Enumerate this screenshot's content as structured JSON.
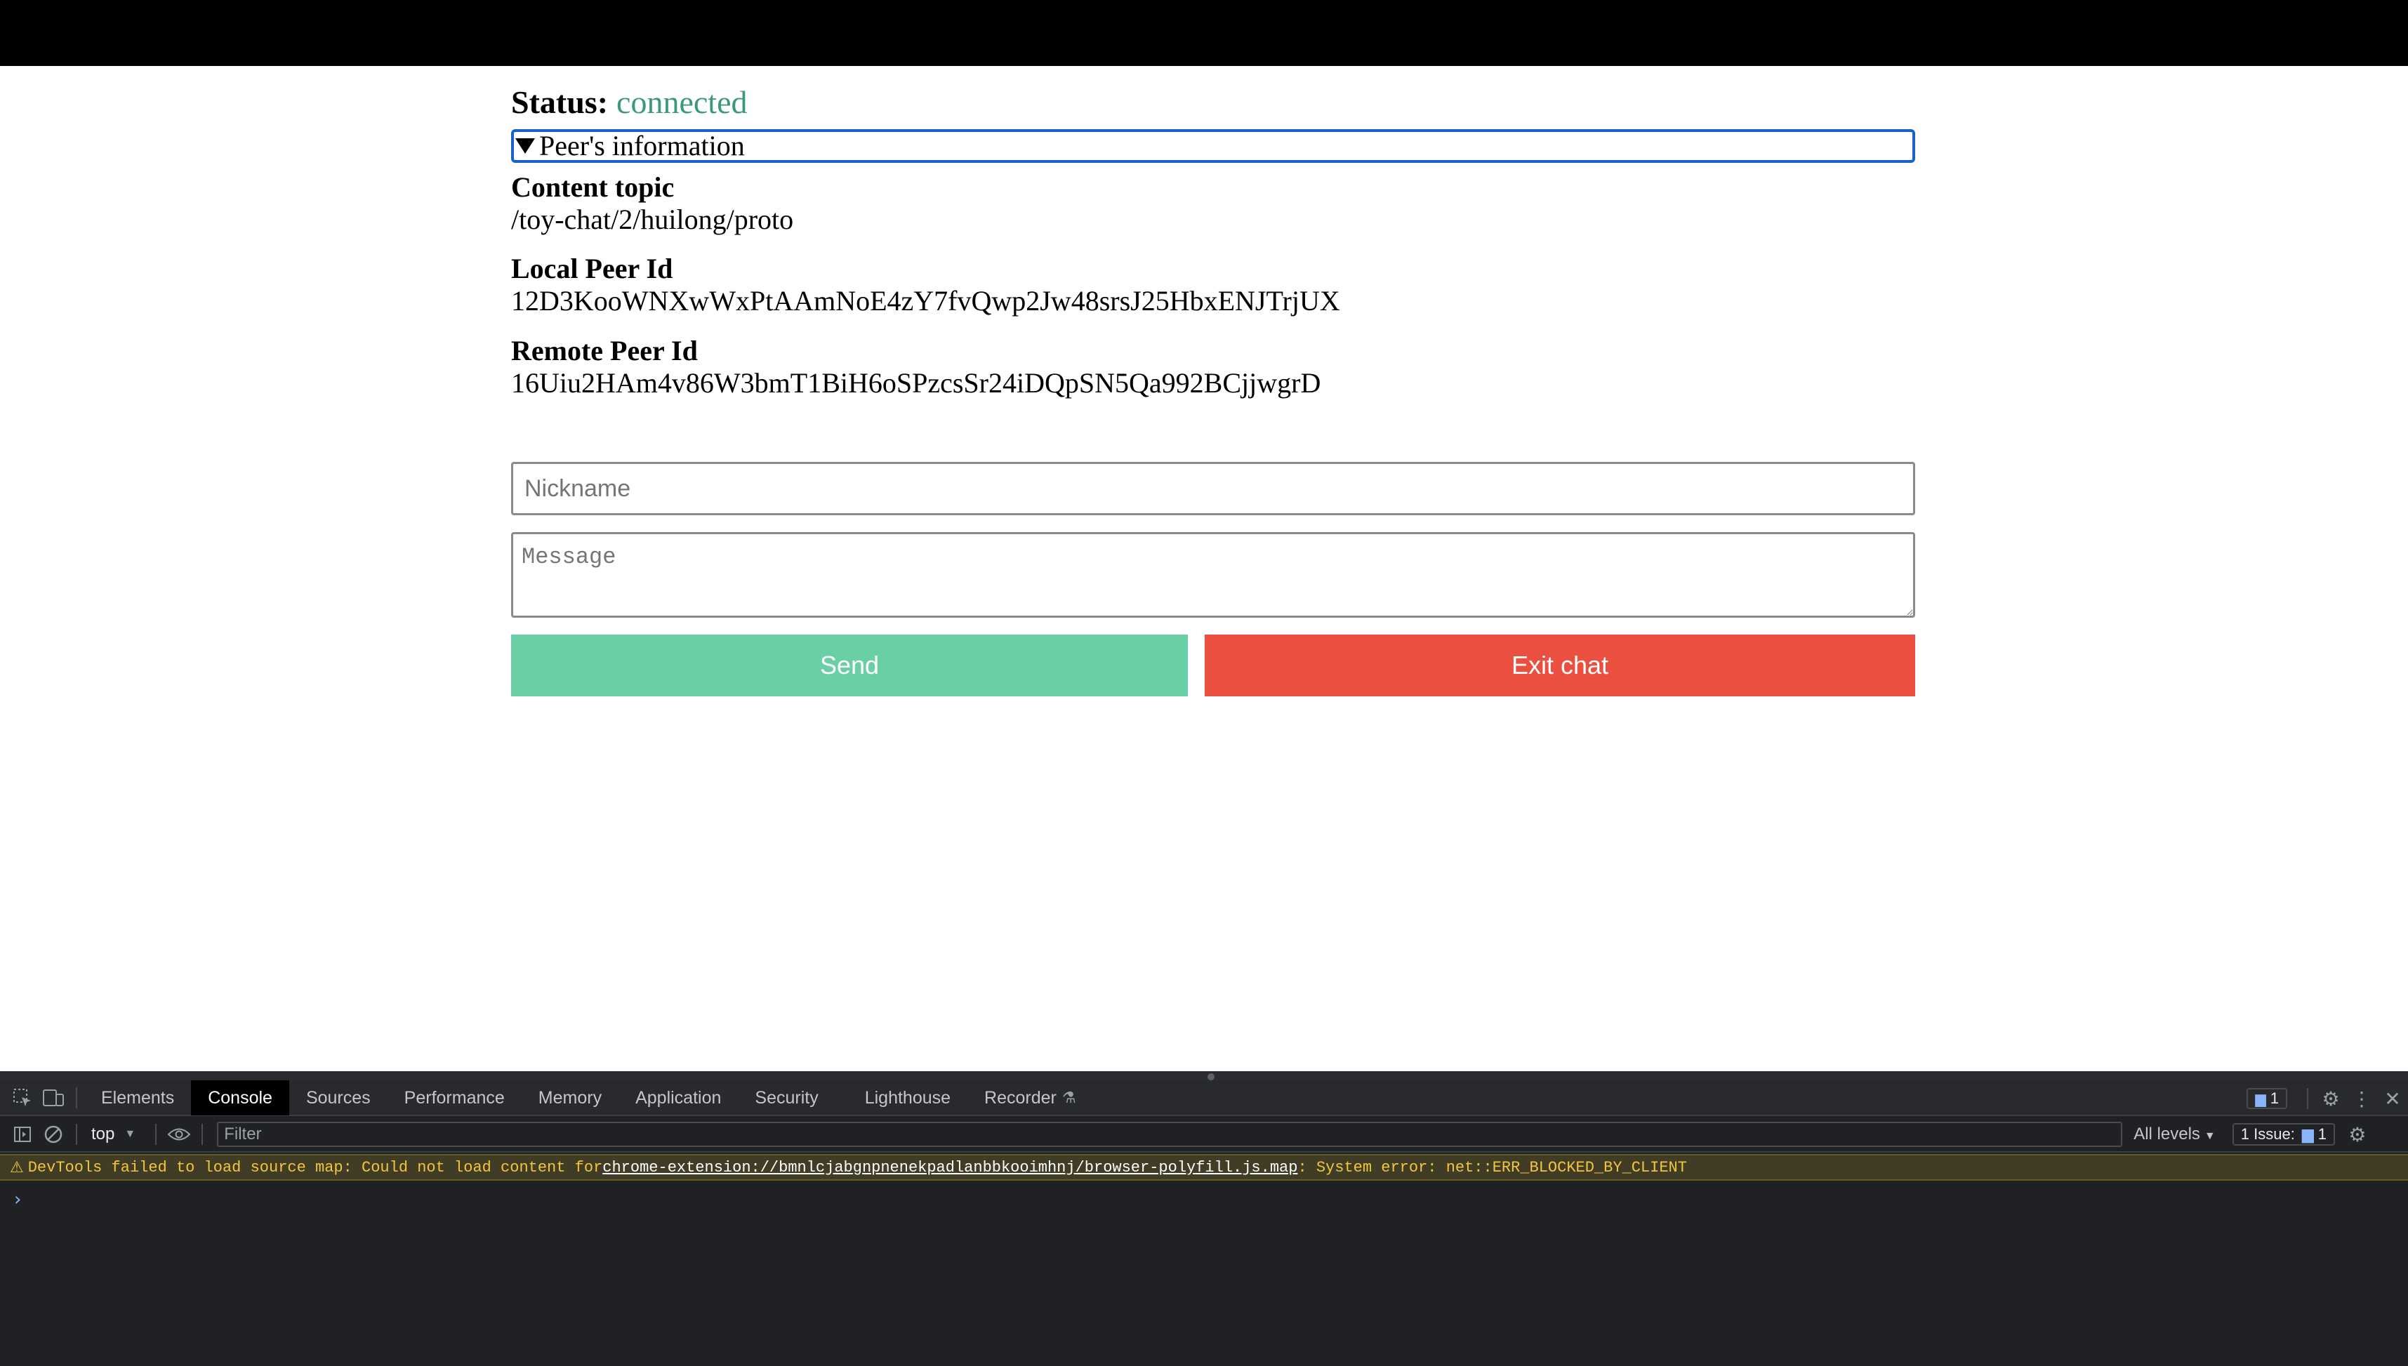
{
  "status": {
    "label": "Status:",
    "value": "connected"
  },
  "peer_info": {
    "summary": "Peer's information",
    "content_topic": {
      "title": "Content topic",
      "value": "/toy-chat/2/huilong/proto"
    },
    "local_peer": {
      "title": "Local Peer Id",
      "value": "12D3KooWNXwWxPtAAmNoE4zY7fvQwp2Jw48srsJ25HbxENJTrjUX"
    },
    "remote_peer": {
      "title": "Remote Peer Id",
      "value": "16Uiu2HAm4v86W3bmT1BiH6oSPzcsSr24iDQpSN5Qa992BCjjwgrD"
    }
  },
  "form": {
    "nickname_placeholder": "Nickname",
    "nickname_value": "",
    "message_placeholder": "Message",
    "message_value": "",
    "send_label": "Send",
    "exit_label": "Exit chat"
  },
  "colors": {
    "status_connected": "#3a9a78",
    "send_button": "#6bcfa5",
    "exit_button": "#ea4f40",
    "focus_outline": "#1a5fd0"
  },
  "devtools": {
    "tabs": [
      {
        "label": "Elements"
      },
      {
        "label": "Console"
      },
      {
        "label": "Sources"
      },
      {
        "label": "Performance"
      },
      {
        "label": "Memory"
      },
      {
        "label": "Application"
      },
      {
        "label": "Security"
      },
      {
        "label": "Lighthouse"
      },
      {
        "label": "Recorder"
      }
    ],
    "active_tab": "Console",
    "message_count": "1",
    "context": "top",
    "filter_placeholder": "Filter",
    "levels": "All levels",
    "issues_label": "1 Issue:",
    "issues_count": "1",
    "warning": {
      "prefix": "DevTools failed to load source map: Could not load content for ",
      "link": "chrome-extension://bmnlcjabgnpnenekpadlanbbkooimhnj/browser-polyfill.js.map",
      "suffix": ": System error: net::ERR_BLOCKED_BY_CLIENT"
    },
    "prompt": "›"
  }
}
